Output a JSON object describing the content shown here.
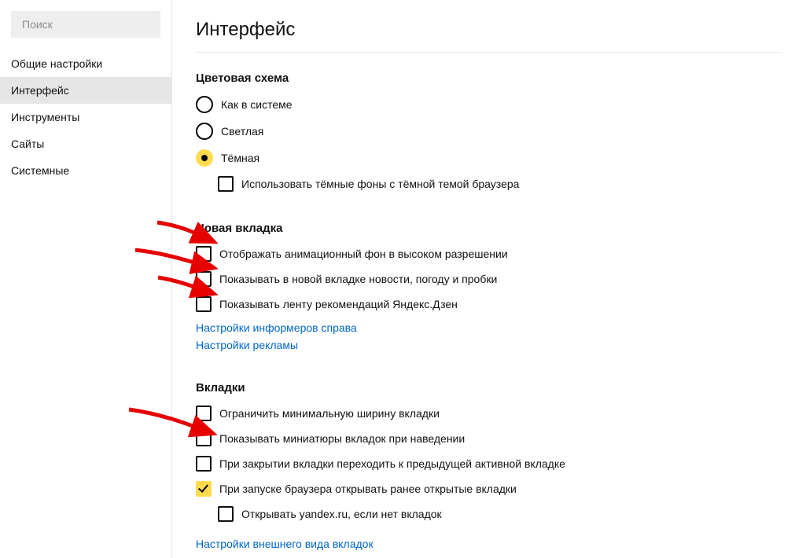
{
  "sidebar": {
    "search_placeholder": "Поиск",
    "items": [
      {
        "label": "Общие настройки",
        "active": false
      },
      {
        "label": "Интерфейс",
        "active": true
      },
      {
        "label": "Инструменты",
        "active": false
      },
      {
        "label": "Сайты",
        "active": false
      },
      {
        "label": "Системные",
        "active": false
      }
    ]
  },
  "page": {
    "title": "Интерфейс"
  },
  "color_scheme": {
    "title": "Цветовая схема",
    "options": [
      {
        "label": "Как в системе",
        "checked": false
      },
      {
        "label": "Светлая",
        "checked": false
      },
      {
        "label": "Тёмная",
        "checked": true
      }
    ],
    "dark_bg_checkbox": {
      "label": "Использовать тёмные фоны с тёмной темой браузера",
      "checked": false
    }
  },
  "new_tab": {
    "title": "Новая вкладка",
    "checkboxes": [
      {
        "label": "Отображать анимационный фон в высоком разрешении",
        "checked": false
      },
      {
        "label": "Показывать в новой вкладке новости, погоду и пробки",
        "checked": false
      },
      {
        "label": "Показывать ленту рекомендаций Яндекс.Дзен",
        "checked": false
      }
    ],
    "links": [
      "Настройки информеров справа",
      "Настройки рекламы"
    ]
  },
  "tabs": {
    "title": "Вкладки",
    "checkboxes": [
      {
        "label": "Ограничить минимальную ширину вкладки",
        "checked": false
      },
      {
        "label": "Показывать миниатюры вкладок при наведении",
        "checked": false
      },
      {
        "label": "При закрытии вкладки переходить к предыдущей активной вкладке",
        "checked": false
      },
      {
        "label": "При запуске браузера открывать ранее открытые вкладки",
        "checked": true
      }
    ],
    "sub_checkbox": {
      "label": "Открывать yandex.ru, если нет вкладок",
      "checked": false
    },
    "link": "Настройки внешнего вида вкладок"
  }
}
